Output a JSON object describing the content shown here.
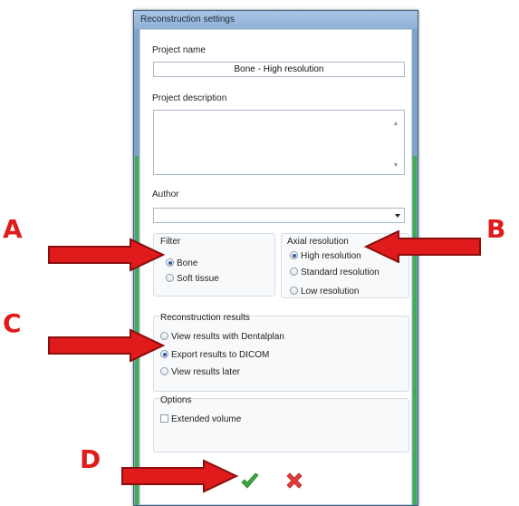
{
  "window": {
    "title": "Reconstruction settings"
  },
  "project_name": {
    "label": "Project name",
    "value": "Bone - High resolution"
  },
  "project_description": {
    "label": "Project description",
    "value": ""
  },
  "author": {
    "label": "Author",
    "value": ""
  },
  "filter": {
    "title": "Filter",
    "options": [
      "Bone",
      "Soft tissue"
    ],
    "selected": "Bone"
  },
  "axial_resolution": {
    "title": "Axial resolution",
    "options": [
      "High resolution",
      "Standard resolution",
      "Low resolution"
    ],
    "selected": "High resolution"
  },
  "reconstruction_results": {
    "title": "Reconstruction results",
    "options": [
      "View results with Dentalplan",
      "Export results to DICOM",
      "View results later"
    ],
    "selected": "Export results to DICOM"
  },
  "options": {
    "title": "Options",
    "extended_volume": "Extended volume",
    "extended_volume_checked": false
  },
  "annotations": {
    "a": "A",
    "b": "B",
    "c": "C",
    "d": "D"
  },
  "colors": {
    "annotation_red": "#e01b1b",
    "ok_green": "#3aa53a",
    "cancel_red": "#e03a3a"
  }
}
